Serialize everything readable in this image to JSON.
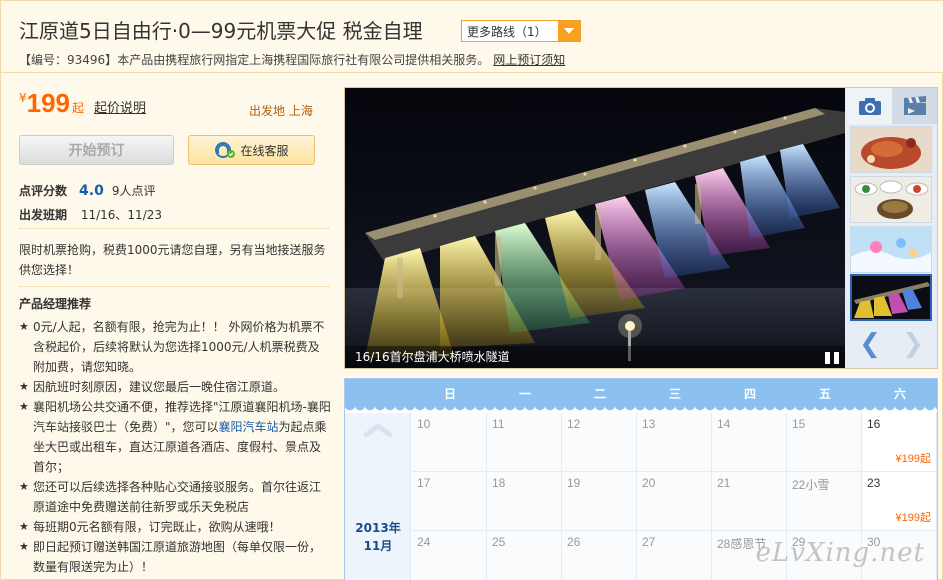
{
  "header": {
    "title": "江原道5日自由行·0—99元机票大促 税金自理",
    "more_routes": "更多路线（1）",
    "product_no_label": "【编号：93496】",
    "product_desc": "本产品由携程旅行网指定上海携程国际旅行社有限公司提供相关服务。",
    "booking_notice": "网上预订须知"
  },
  "pricing": {
    "currency": "¥",
    "price": "199",
    "suffix": "起",
    "explain": "起价说明",
    "departure": "出发地 上海"
  },
  "actions": {
    "book_label": "开始预订",
    "service_label": "在线客服"
  },
  "rating": {
    "label": "点评分数",
    "score": "4.0",
    "count": "9人点评"
  },
  "schedule": {
    "label": "出发班期",
    "dates": "11/16、11/23"
  },
  "notice": "限时机票抢购，税费1000元请您自理，另有当地接送服务供您选择！",
  "manager": {
    "title": "产品经理推荐",
    "items": [
      "0元/人起，名额有限，抢完为止！！ 外网价格为机票不含税起价，后续将默认为您选择1000元/人机票税费及附加费，请您知晓。",
      "因航班时刻原因，建议您最后一晚住宿江原道。",
      "襄阳机场公共交通不便，推荐选择\"江原道襄阳机场-襄阳汽车站接驳巴士（免费）\"，您可以",
      "您还可以后续选择各种贴心交通接驳服务。首尔往返江原道途中免费赠送前往新罗或乐天免税店",
      "每班期0元名额有限，订完既止，欲购从速哦！",
      "即日起预订赠送韩国江原道旅游地图（每单仅限一份，数量有限送完为止）！"
    ],
    "item3_link": "襄阳汽车站",
    "item3_tail": "为起点乘坐大巴或出租车，直达江原道各酒店、度假村、景点及首尔；"
  },
  "gallery": {
    "caption": "16/16首尔盘浦大桥喷水隧道",
    "prev": "❮",
    "next": "❯"
  },
  "calendar": {
    "weekdays": [
      "日",
      "一",
      "二",
      "三",
      "四",
      "五",
      "六"
    ],
    "month_year": "2013年",
    "month": "11月",
    "rows": [
      [
        {
          "d": "10",
          "p": ""
        },
        {
          "d": "11",
          "p": ""
        },
        {
          "d": "12",
          "p": ""
        },
        {
          "d": "13",
          "p": ""
        },
        {
          "d": "14",
          "p": ""
        },
        {
          "d": "15",
          "p": ""
        },
        {
          "d": "16",
          "p": "¥199起"
        }
      ],
      [
        {
          "d": "17",
          "p": ""
        },
        {
          "d": "18",
          "p": ""
        },
        {
          "d": "19",
          "p": ""
        },
        {
          "d": "20",
          "p": ""
        },
        {
          "d": "21",
          "p": ""
        },
        {
          "d": "22小雪",
          "p": ""
        },
        {
          "d": "23",
          "p": "¥199起"
        }
      ],
      [
        {
          "d": "24",
          "p": ""
        },
        {
          "d": "25",
          "p": ""
        },
        {
          "d": "26",
          "p": ""
        },
        {
          "d": "27",
          "p": ""
        },
        {
          "d": "28感恩节",
          "p": ""
        },
        {
          "d": "29",
          "p": ""
        },
        {
          "d": "30",
          "p": ""
        }
      ]
    ]
  },
  "watermark": "eLvXing.net",
  "colors": {
    "accent_orange": "#f60",
    "link_blue": "#1a5ea8",
    "calendar_header": "#8cc0ee",
    "page_bg": "#fef9ea"
  }
}
